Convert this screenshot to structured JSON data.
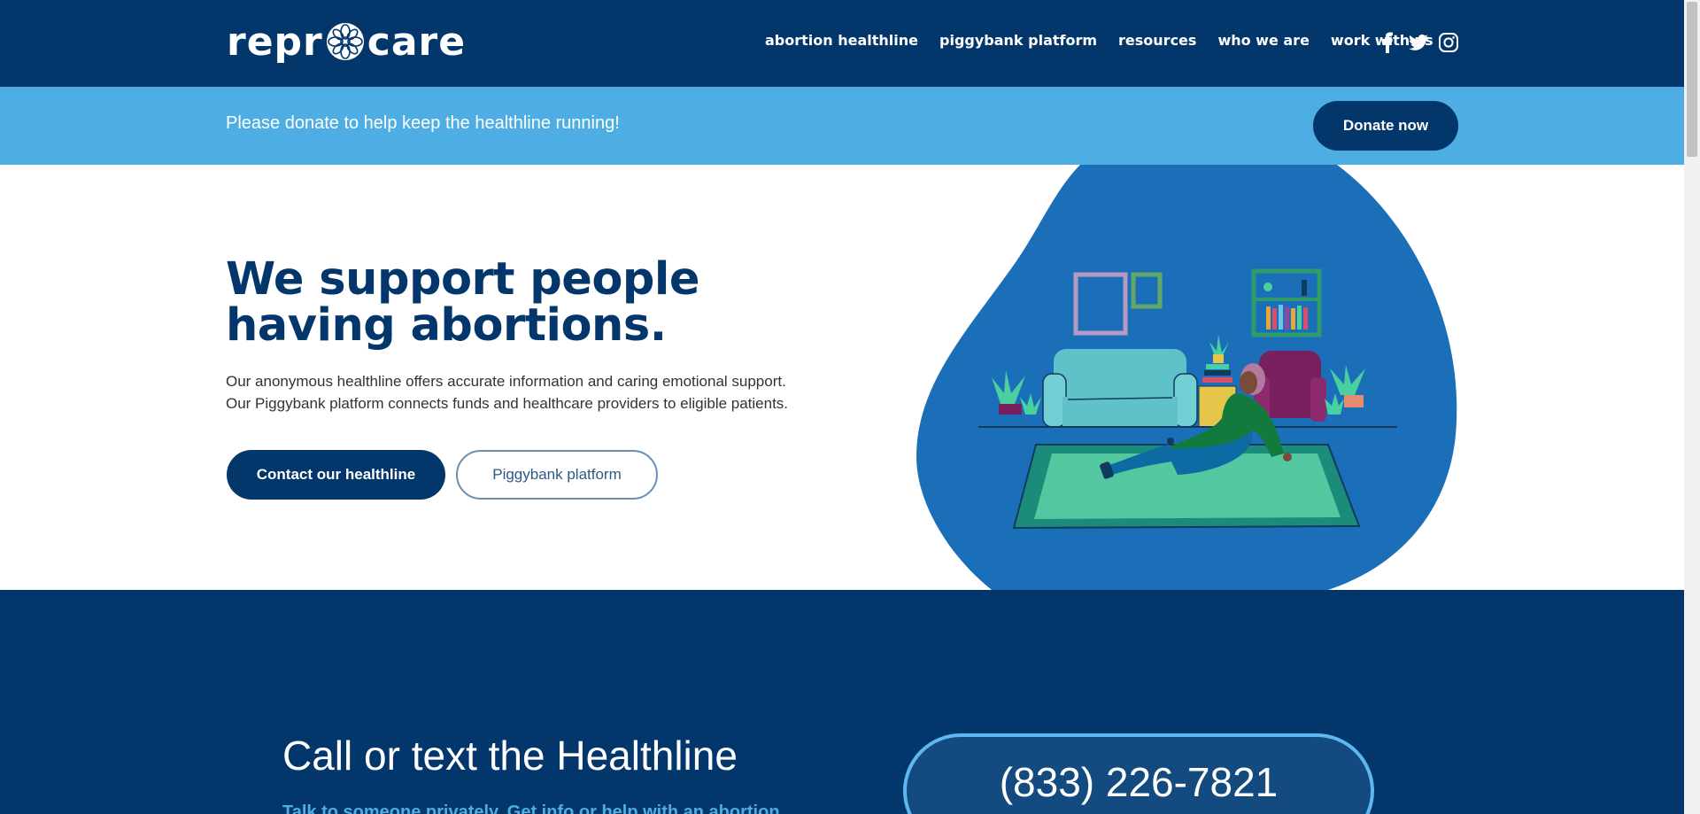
{
  "header": {
    "logo_text_left": "repr",
    "logo_text_right": "care",
    "nav": [
      {
        "label": "abortion healthline"
      },
      {
        "label": "piggybank platform"
      },
      {
        "label": "resources"
      },
      {
        "label": "who we are"
      },
      {
        "label": "work with us"
      }
    ],
    "social_icons": [
      "facebook-icon",
      "twitter-icon",
      "instagram-icon"
    ]
  },
  "banner": {
    "text": "Please donate to help keep the healthline running!",
    "button_label": "Donate now"
  },
  "hero": {
    "title": "We support people having abortions.",
    "line1": "Our anonymous healthline offers accurate information and caring emotional support.",
    "line2": "Our Piggybank platform connects funds and healthcare providers to eligible patients.",
    "primary_button": "Contact our healthline",
    "secondary_button": "Piggybank platform"
  },
  "healthline": {
    "title": "Call or text the Healthline",
    "subtitle": "Talk to someone privately. Get info or help with an abortion.",
    "phone": "(833) 226-7821"
  },
  "colors": {
    "navy": "#03376b",
    "light_blue": "#4eaee3",
    "blob_blue": "#1a6fb8"
  }
}
